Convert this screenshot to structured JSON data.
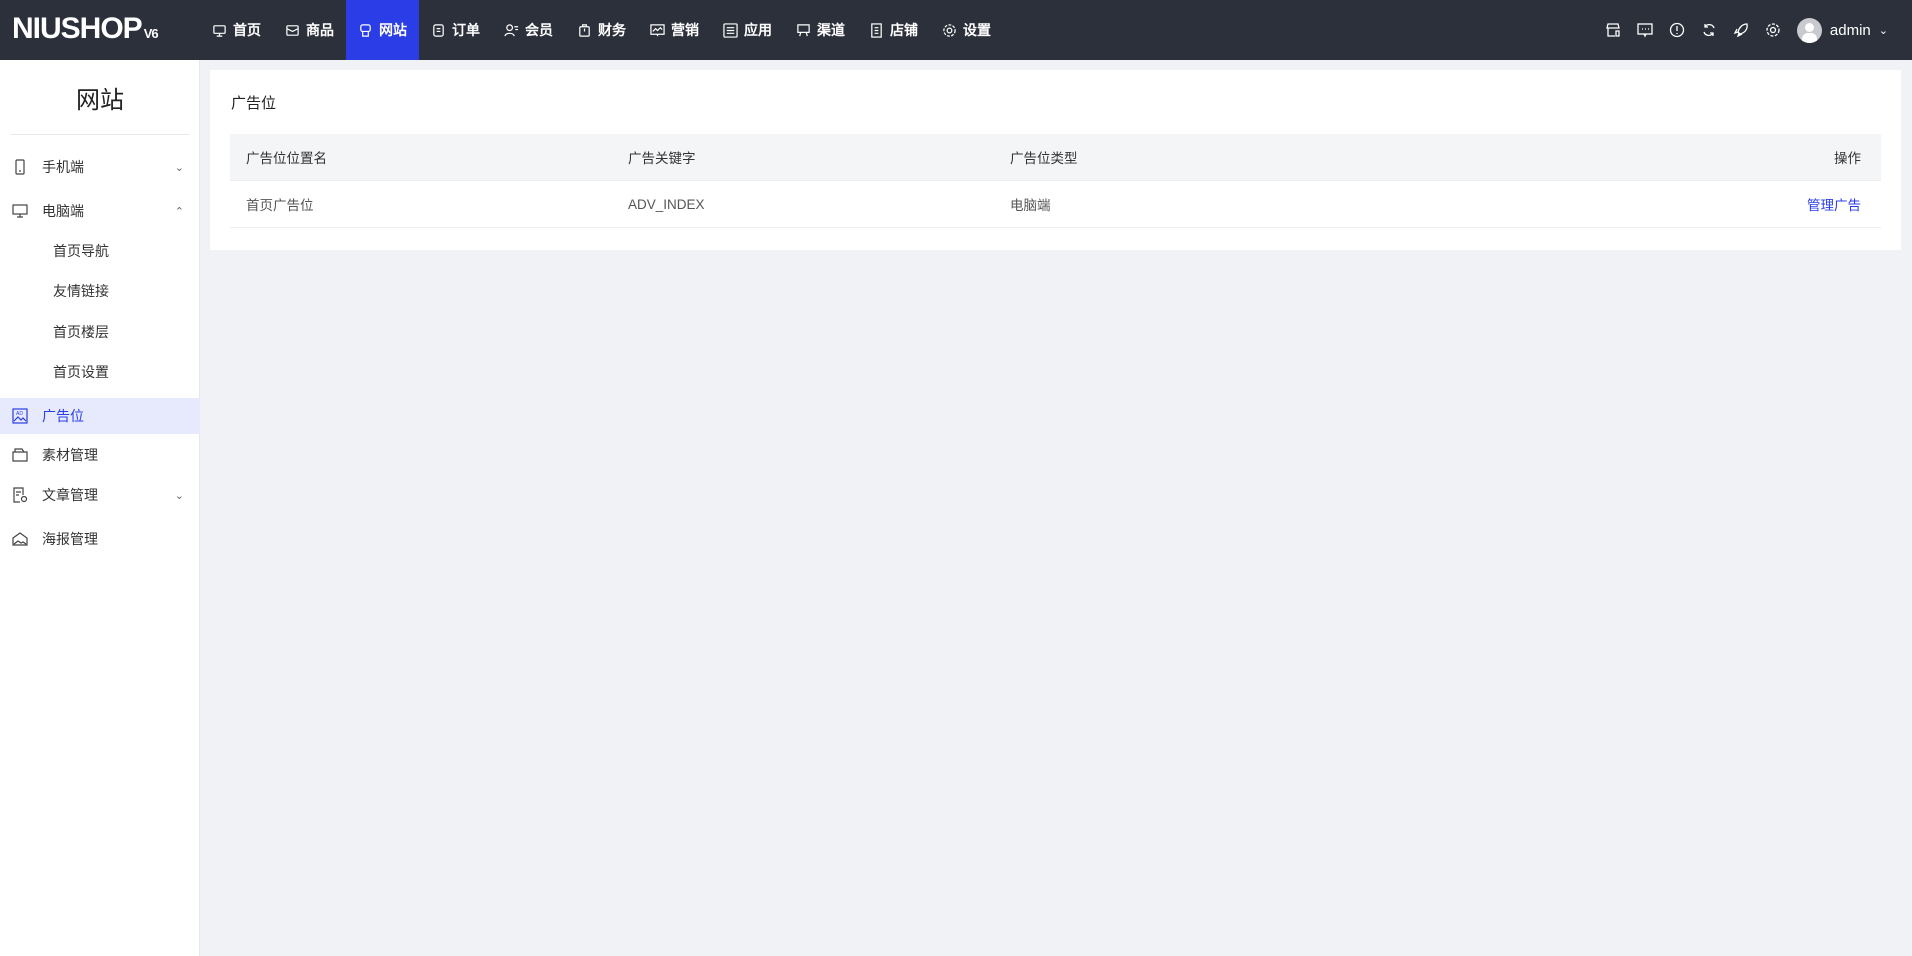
{
  "brand": {
    "logo": "NIUSHOP",
    "version": "V6"
  },
  "nav": [
    {
      "label": "首页",
      "icon": "monitor-icon"
    },
    {
      "label": "商品",
      "icon": "box-icon"
    },
    {
      "label": "网站",
      "icon": "site-icon",
      "active": true
    },
    {
      "label": "订单",
      "icon": "clipboard-icon"
    },
    {
      "label": "会员",
      "icon": "user-icon"
    },
    {
      "label": "财务",
      "icon": "bag-icon"
    },
    {
      "label": "营销",
      "icon": "chart-icon"
    },
    {
      "label": "应用",
      "icon": "apps-icon"
    },
    {
      "label": "渠道",
      "icon": "channel-icon"
    },
    {
      "label": "店铺",
      "icon": "store-icon"
    },
    {
      "label": "设置",
      "icon": "gear-icon"
    }
  ],
  "user": {
    "name": "admin"
  },
  "sidebar": {
    "title": "网站",
    "items": [
      {
        "label": "手机端"
      },
      {
        "label": "电脑端"
      },
      {
        "label": "首页导航"
      },
      {
        "label": "友情链接"
      },
      {
        "label": "首页楼层"
      },
      {
        "label": "首页设置"
      },
      {
        "label": "广告位"
      },
      {
        "label": "素材管理"
      },
      {
        "label": "文章管理"
      },
      {
        "label": "海报管理"
      }
    ]
  },
  "main": {
    "title": "广告位",
    "columns": [
      "广告位位置名",
      "广告关键字",
      "广告位类型",
      "操作"
    ],
    "rows": [
      {
        "name": "首页广告位",
        "key": "ADV_INDEX",
        "type": "电脑端",
        "action": "管理广告"
      }
    ]
  }
}
